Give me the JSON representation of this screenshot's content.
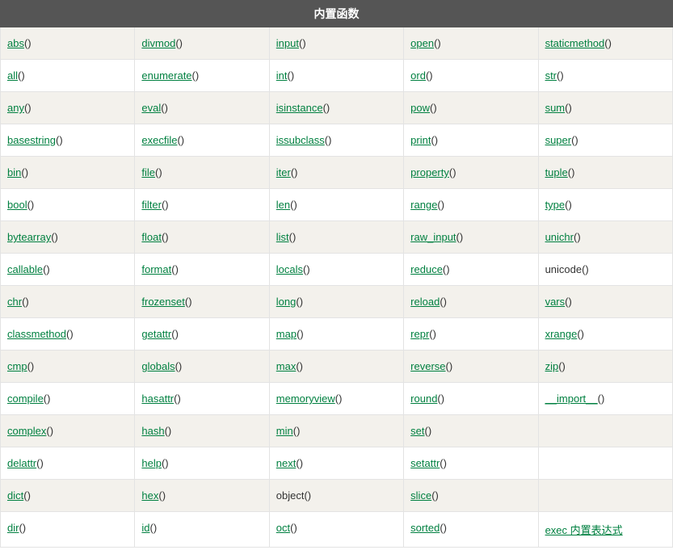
{
  "header": "内置函数",
  "rows": [
    [
      {
        "link": "abs",
        "suffix": "()"
      },
      {
        "link": "divmod",
        "suffix": "()"
      },
      {
        "link": "input",
        "suffix": "()"
      },
      {
        "link": "open",
        "suffix": "()"
      },
      {
        "link": "staticmethod",
        "suffix": "()"
      }
    ],
    [
      {
        "link": "all",
        "suffix": "()"
      },
      {
        "link": "enumerate",
        "suffix": "()"
      },
      {
        "link": "int",
        "suffix": "()"
      },
      {
        "link": "ord",
        "suffix": "()"
      },
      {
        "link": "str",
        "suffix": "()"
      }
    ],
    [
      {
        "link": "any",
        "suffix": "()"
      },
      {
        "link": "eval",
        "suffix": "()"
      },
      {
        "link": "isinstance",
        "suffix": "()"
      },
      {
        "link": "pow",
        "suffix": "()"
      },
      {
        "link": "sum",
        "suffix": "()"
      }
    ],
    [
      {
        "link": "basestring",
        "suffix": "()"
      },
      {
        "link": "execfile",
        "suffix": "()"
      },
      {
        "link": "issubclass",
        "suffix": "()"
      },
      {
        "link": "print",
        "suffix": "()"
      },
      {
        "link": "super",
        "suffix": "()"
      }
    ],
    [
      {
        "link": "bin",
        "suffix": "()"
      },
      {
        "link": "file",
        "suffix": "()"
      },
      {
        "link": "iter",
        "suffix": "()"
      },
      {
        "link": "property",
        "suffix": "()"
      },
      {
        "link": "tuple",
        "suffix": "()"
      }
    ],
    [
      {
        "link": "bool",
        "suffix": "()"
      },
      {
        "link": "filter",
        "suffix": "()"
      },
      {
        "link": "len",
        "suffix": "()"
      },
      {
        "link": "range",
        "suffix": "()"
      },
      {
        "link": "type",
        "suffix": "()"
      }
    ],
    [
      {
        "link": "bytearray",
        "suffix": "()"
      },
      {
        "link": "float",
        "suffix": "()"
      },
      {
        "link": "list",
        "suffix": "()"
      },
      {
        "link": "raw_input",
        "suffix": "()"
      },
      {
        "link": "unichr",
        "suffix": "()"
      }
    ],
    [
      {
        "link": "callable",
        "suffix": "()"
      },
      {
        "link": "format",
        "suffix": "()"
      },
      {
        "link": "locals",
        "suffix": "()"
      },
      {
        "link": "reduce",
        "suffix": "()"
      },
      {
        "plain": "unicode()"
      }
    ],
    [
      {
        "link": "chr",
        "suffix": "()"
      },
      {
        "link": "frozenset",
        "suffix": "()"
      },
      {
        "link": "long",
        "suffix": "()"
      },
      {
        "link": "reload",
        "suffix": "()"
      },
      {
        "link": "vars",
        "suffix": "()"
      }
    ],
    [
      {
        "link": "classmethod",
        "suffix": "()"
      },
      {
        "link": "getattr",
        "suffix": "()"
      },
      {
        "link": "map",
        "suffix": "()"
      },
      {
        "link": "repr",
        "suffix": "()"
      },
      {
        "link": "xrange",
        "suffix": "()"
      }
    ],
    [
      {
        "link": "cmp",
        "suffix": "()"
      },
      {
        "link": "globals",
        "suffix": "()"
      },
      {
        "link": "max",
        "suffix": "()"
      },
      {
        "link": "reverse",
        "suffix": "()"
      },
      {
        "link": "zip",
        "suffix": "()"
      }
    ],
    [
      {
        "link": "compile",
        "suffix": "()"
      },
      {
        "link": "hasattr",
        "suffix": "()"
      },
      {
        "link": "memoryview",
        "suffix": "()"
      },
      {
        "link": "round",
        "suffix": "()"
      },
      {
        "link": "__import__",
        "suffix": "()"
      }
    ],
    [
      {
        "link": "complex",
        "suffix": "()"
      },
      {
        "link": "hash",
        "suffix": "()"
      },
      {
        "link": "min",
        "suffix": "()"
      },
      {
        "link": "set",
        "suffix": "()"
      },
      {
        "empty": true
      }
    ],
    [
      {
        "link": "delattr",
        "suffix": "()"
      },
      {
        "link": "help",
        "suffix": "()"
      },
      {
        "link": "next",
        "suffix": "()"
      },
      {
        "link": "setattr",
        "suffix": "()"
      },
      {
        "empty": true
      }
    ],
    [
      {
        "link": "dict",
        "suffix": "()"
      },
      {
        "link": "hex",
        "suffix": "()"
      },
      {
        "plain": "object()"
      },
      {
        "link": "slice",
        "suffix": "()"
      },
      {
        "empty": true
      }
    ],
    [
      {
        "link": "dir",
        "suffix": "()"
      },
      {
        "link": "id",
        "suffix": "()"
      },
      {
        "link": "oct",
        "suffix": "()"
      },
      {
        "link": "sorted",
        "suffix": "()"
      },
      {
        "link": "exec 内置表达式",
        "suffix": ""
      }
    ]
  ]
}
